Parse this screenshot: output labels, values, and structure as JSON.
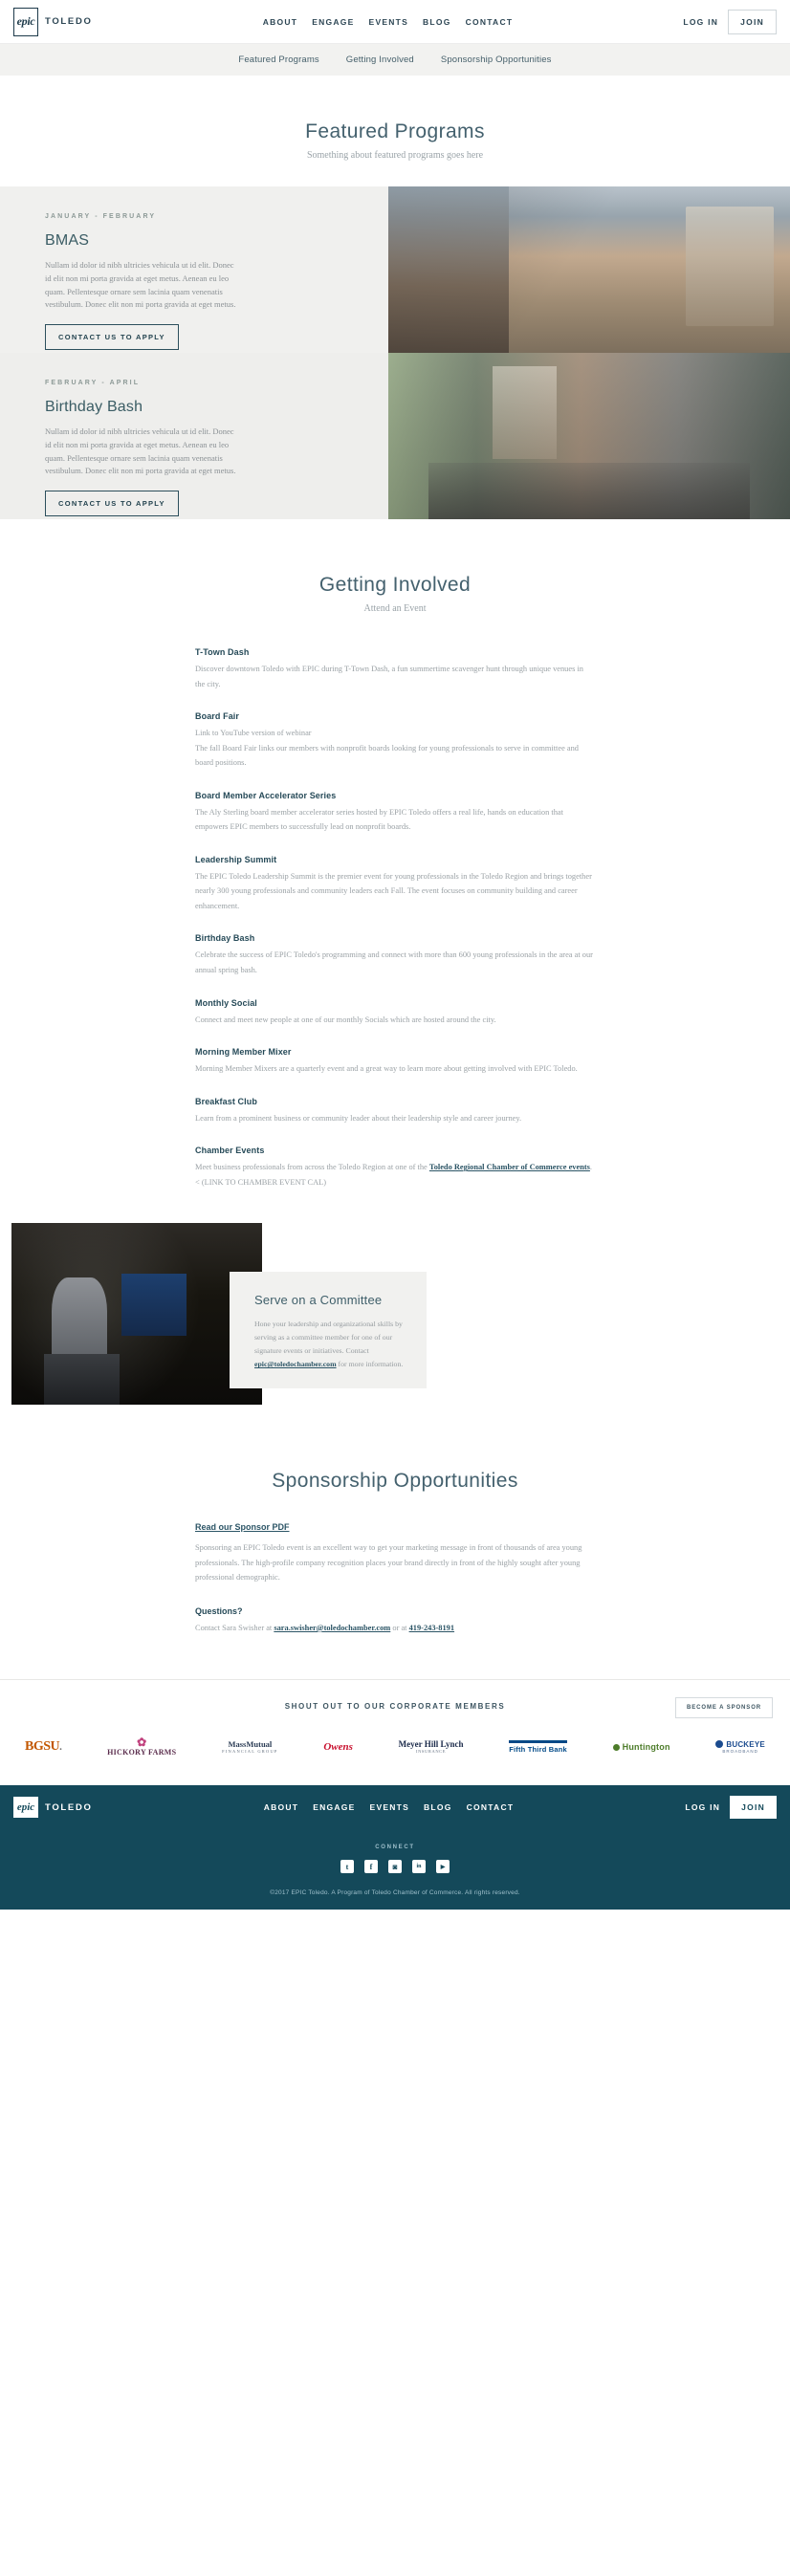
{
  "header": {
    "logo_mark": "epic",
    "logo_word": "TOLEDO",
    "nav": [
      {
        "label": "ABOUT"
      },
      {
        "label": "ENGAGE"
      },
      {
        "label": "EVENTS"
      },
      {
        "label": "BLOG"
      },
      {
        "label": "CONTACT"
      }
    ],
    "login_label": "LOG IN",
    "join_label": "JOIN"
  },
  "subnav": [
    {
      "label": "Featured Programs"
    },
    {
      "label": "Getting Involved"
    },
    {
      "label": "Sponsorship Opportunities"
    }
  ],
  "featured": {
    "title": "Featured Programs",
    "subtitle": "Something about featured programs goes here",
    "cards": [
      {
        "kicker": "JANUARY - FEBRUARY",
        "title": "BMAS",
        "body": "Nullam id dolor id nibh ultricies vehicula ut id elit. Donec id elit non mi porta gravida at eget metus. Aenean eu leo quam. Pellentesque ornare sem lacinia quam venenatis vestibulum. Donec elit non mi porta gravida at eget metus.",
        "button": "CONTACT US TO APPLY"
      },
      {
        "kicker": "FEBRUARY - APRIL",
        "title": "Birthday Bash",
        "body": "Nullam id dolor id nibh ultricies vehicula ut id elit. Donec id elit non mi porta gravida at eget metus. Aenean eu leo quam. Pellentesque ornare sem lacinia quam venenatis vestibulum. Donec elit non mi porta gravida at eget metus.",
        "button": "CONTACT US TO APPLY"
      }
    ]
  },
  "involved": {
    "title": "Getting Involved",
    "subtitle": "Attend an Event",
    "events": [
      {
        "name": "T-Town Dash",
        "desc": "Discover downtown Toledo with EPIC during T-Town Dash,  a fun summertime scavenger hunt through unique venues in the city."
      },
      {
        "name": "Board Fair",
        "desc": "Link to YouTube version of webinar\nThe fall Board Fair links our members with nonprofit boards looking for young professionals to serve  in committee and board positions."
      },
      {
        "name": "Board Member Accelerator Series",
        "desc": "The Aly Sterling board member accelerator series hosted by EPIC Toledo offers a real life, hands on education that empowers EPIC members to successfully lead on nonprofit boards."
      },
      {
        "name": "Leadership Summit",
        "desc": "The EPIC Toledo Leadership Summit is the premier event for young professionals in the Toledo Region and brings together nearly 300 young professionals and community leaders each Fall. The event focuses on community building and career enhancement."
      },
      {
        "name": "Birthday Bash",
        "desc": "Celebrate the success of EPIC Toledo's programming and connect with more than 600 young professionals in the area at our annual spring bash."
      },
      {
        "name": "Monthly Social",
        "desc": "Connect and meet new people at one of our monthly Socials which are hosted around the city."
      },
      {
        "name": "Morning Member Mixer",
        "desc": "Morning Member Mixers are a quarterly event and a great way to learn more about getting involved with EPIC Toledo."
      },
      {
        "name": "Breakfast Club",
        "desc": "Learn from a prominent business or community leader about their leadership style and career journey."
      },
      {
        "name": "Chamber Events",
        "desc_before": "Meet business professionals from across the Toledo Region at one of the ",
        "desc_link": "Toledo Regional Chamber of Commerce events",
        "desc_after": ". < (LINK TO CHAMBER EVENT CAL)"
      }
    ]
  },
  "committee": {
    "title": "Serve on a Committee",
    "body_before": "Hone your leadership and organizational skills by serving as a committee member for one of our signature events or initiatives. Contact ",
    "email": "epic@toledochamber.com",
    "body_after": " for more information."
  },
  "sponsorship": {
    "title": "Sponsorship Opportunities",
    "pdf_link": "Read our Sponsor PDF",
    "paragraph": "Sponsoring an EPIC Toledo event is an excellent way to get your marketing message in front of thousands of area young professionals. The high-profile company recognition places your brand directly in front of the highly sought after young professional demographic.",
    "questions_heading": "Questions?",
    "contact_before": "Contact Sara Swisher at ",
    "contact_email": "sara.swisher@toledochamber.com",
    "contact_mid": " or at ",
    "contact_phone": "419-243-8191"
  },
  "members": {
    "title": "SHOUT OUT TO OUR CORPORATE MEMBERS",
    "become_button": "BECOME A SPONSOR",
    "logos": [
      {
        "name": "BGSU",
        "text": "BGSU",
        "suffix": "."
      },
      {
        "name": "Hickory Farms",
        "line1": "HICKORY FARMS"
      },
      {
        "name": "MassMutual",
        "line1": "MassMutual",
        "line2": "FINANCIAL GROUP"
      },
      {
        "name": "Owens",
        "line1": "Owens"
      },
      {
        "name": "Meyer Hill Lynch",
        "line1": "Meyer Hill Lynch",
        "line2": "INSURANCE"
      },
      {
        "name": "Fifth Third Bank",
        "line1": "Fifth Third Bank"
      },
      {
        "name": "Huntington",
        "line1": "Huntington"
      },
      {
        "name": "Buckeye Broadband",
        "line1": "BUCKEYE",
        "line2": "BROADBAND"
      }
    ]
  },
  "footer": {
    "logo_mark": "epic",
    "logo_word": "TOLEDO",
    "nav": [
      {
        "label": "ABOUT"
      },
      {
        "label": "ENGAGE"
      },
      {
        "label": "EVENTS"
      },
      {
        "label": "BLOG"
      },
      {
        "label": "CONTACT"
      }
    ],
    "login_label": "LOG IN",
    "join_label": "JOIN",
    "connect_label": "CONNECT",
    "socials": [
      {
        "icon": "twitter-icon",
        "glyph": "t"
      },
      {
        "icon": "facebook-icon",
        "glyph": "f"
      },
      {
        "icon": "instagram-icon",
        "glyph": "◙"
      },
      {
        "icon": "linkedin-icon",
        "glyph": "in"
      },
      {
        "icon": "youtube-icon",
        "glyph": "▶"
      }
    ],
    "copyright": "©2017 EPIC Toledo. A Program of Toledo Chamber of Commerce. All rights reserved."
  },
  "colors": {
    "brand_teal": "#14495a",
    "heading": "#44616e",
    "muted": "#9ba2a6",
    "card_bg": "#f0f0ee"
  }
}
